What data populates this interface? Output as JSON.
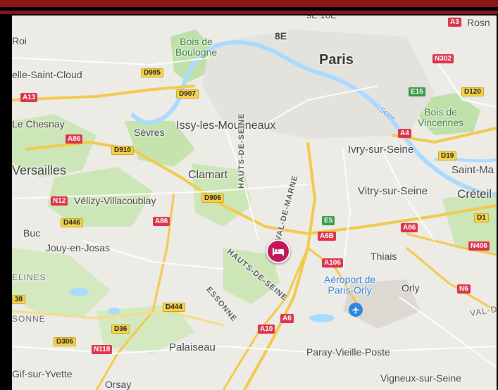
{
  "map": {
    "places": {
      "roi": "Roi",
      "rosny": "Rosn",
      "bois_boulogne": "Bois de\nBoulogne",
      "paris": "Paris",
      "arr_8e": "8E",
      "arr_top": "9E  10E",
      "la_celle": "elle-Saint-Cloud",
      "le_chesnay": "Le Chesnay",
      "sevres": "Sèvres",
      "issy": "Issy-les-Moulineaux",
      "versailles": "Versailles",
      "clamart": "Clamart",
      "ivry": "Ivry-sur-Seine",
      "saint_maur": "Saint-Ma",
      "velizy": "Vélizy-Villacoublay",
      "vitry": "Vitry-sur-Seine",
      "creteil": "Créteil",
      "buc": "Buc",
      "jouy": "Jouy-en-Josas",
      "thiais": "Thiais",
      "yvelines": "ELINES",
      "aeroport": "Aéroport de\nParis-Orly",
      "orly": "Orly",
      "val_de_marne_short": "VAL-D",
      "essonne_left": "SONNE",
      "palaiseau": "Palaiseau",
      "paray": "Paray-Vieille-Poste",
      "gif": "Gif-sur-Yvette",
      "orsay": "Orsay",
      "vigneux": "Vigneux-sur-Seine",
      "bois_vincennes": "Bois de\nVincennes",
      "seine": "Seine"
    },
    "regions": {
      "hauts_de_seine_v": "HAUTS-DE-SEINE",
      "val_de_marne_v": "VAL-DE-MARNE",
      "hauts_de_seine_diag": "HAUTS-DE-SEINE",
      "essonne_diag": "ESSONNE"
    },
    "roads": {
      "a3": "A3",
      "d985": "D985",
      "a13": "A13",
      "d907": "D907",
      "a86a": "A86",
      "d910": "D910",
      "n302": "N302",
      "e15": "E15",
      "d120": "D120",
      "a4": "A4",
      "d19": "D19",
      "d906": "D906",
      "n12": "N12",
      "d446": "D446",
      "a86b": "A86",
      "e5": "E5",
      "a6b": "A6B",
      "a86c": "A86",
      "d1": "D1",
      "n406": "N406",
      "a106": "A106",
      "n6": "N6",
      "d444": "D444",
      "a6": "A6",
      "a10": "A10",
      "d36": "D36",
      "d306": "D306",
      "n118": "N118",
      "n38": "38"
    },
    "markers": {
      "hotel": "hotel-icon",
      "airport": "airplane-icon"
    },
    "colors": {
      "land": "#ecebe6",
      "park": "#bfe0a8",
      "water": "#aadaff",
      "highway": "#f2c94c",
      "hotel": "#c2185b",
      "airport": "#2f86e0",
      "frame": "#8c1515"
    }
  }
}
